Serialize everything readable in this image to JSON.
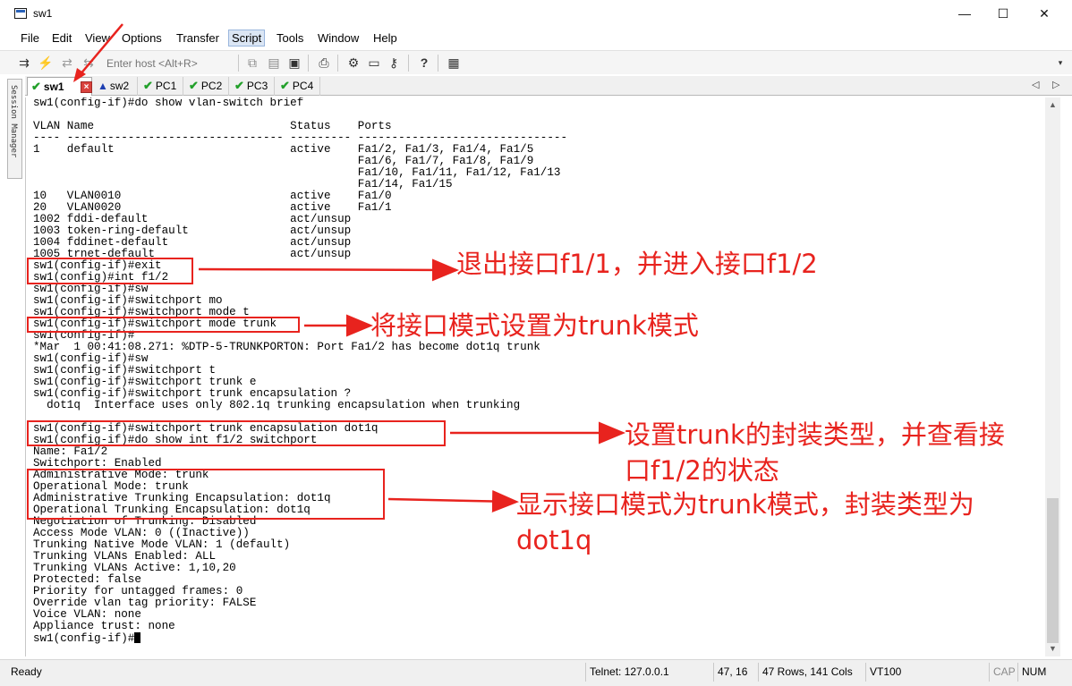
{
  "window": {
    "title": "sw1",
    "minimize": "—",
    "maximize": "☐",
    "close": "✕"
  },
  "menu": [
    "File",
    "Edit",
    "View",
    "Options",
    "Transfer",
    "Script",
    "Tools",
    "Window",
    "Help"
  ],
  "toolbar": {
    "host_placeholder": "Enter host <Alt+R>"
  },
  "tabs": [
    {
      "label": "sw1",
      "status": "connected",
      "active": true
    },
    {
      "label": "sw2",
      "status": "warning",
      "active": false
    },
    {
      "label": "PC1",
      "status": "connected",
      "active": false
    },
    {
      "label": "PC2",
      "status": "connected",
      "active": false
    },
    {
      "label": "PC3",
      "status": "connected",
      "active": false
    },
    {
      "label": "PC4",
      "status": "connected",
      "active": false
    }
  ],
  "session_manager": "Session Manager",
  "terminal_lines": [
    "sw1(config-if)#do show vlan-switch brief",
    "",
    "VLAN Name                             Status    Ports",
    "---- -------------------------------- --------- -------------------------------",
    "1    default                          active    Fa1/2, Fa1/3, Fa1/4, Fa1/5",
    "                                                Fa1/6, Fa1/7, Fa1/8, Fa1/9",
    "                                                Fa1/10, Fa1/11, Fa1/12, Fa1/13",
    "                                                Fa1/14, Fa1/15",
    "10   VLAN0010                         active    Fa1/0",
    "20   VLAN0020                         active    Fa1/1",
    "1002 fddi-default                     act/unsup",
    "1003 token-ring-default               act/unsup",
    "1004 fddinet-default                  act/unsup",
    "1005 trnet-default                    act/unsup",
    "sw1(config-if)#exit",
    "sw1(config)#int f1/2",
    "sw1(config-if)#sw",
    "sw1(config-if)#switchport mo",
    "sw1(config-if)#switchport mode t",
    "sw1(config-if)#switchport mode trunk",
    "sw1(config-if)#",
    "*Mar  1 00:41:08.271: %DTP-5-TRUNKPORTON: Port Fa1/2 has become dot1q trunk",
    "sw1(config-if)#sw",
    "sw1(config-if)#switchport t",
    "sw1(config-if)#switchport trunk e",
    "sw1(config-if)#switchport trunk encapsulation ?",
    "  dot1q  Interface uses only 802.1q trunking encapsulation when trunking",
    "",
    "sw1(config-if)#switchport trunk encapsulation dot1q",
    "sw1(config-if)#do show int f1/2 switchport",
    "Name: Fa1/2",
    "Switchport: Enabled",
    "Administrative Mode: trunk",
    "Operational Mode: trunk",
    "Administrative Trunking Encapsulation: dot1q",
    "Operational Trunking Encapsulation: dot1q",
    "Negotiation of Trunking: Disabled",
    "Access Mode VLAN: 0 ((Inactive))",
    "Trunking Native Mode VLAN: 1 (default)",
    "Trunking VLANs Enabled: ALL",
    "Trunking VLANs Active: 1,10,20",
    "Protected: false",
    "Priority for untagged frames: 0",
    "Override vlan tag priority: FALSE",
    "Voice VLAN: none",
    "Appliance trust: none",
    "sw1(config-if)#"
  ],
  "annotations": {
    "exit_int": "退出接口f1/1，并进入接口f1/2",
    "mode_trunk": "将接口模式设置为trunk模式",
    "encap_line1": "设置trunk的封装类型，并查看接",
    "encap_line2": "口f1/2的状态",
    "show_line1": "显示接口模式为trunk模式，封装类型为",
    "show_line2": "dot1q"
  },
  "status": {
    "state": "Ready",
    "connection": "Telnet: 127.0.0.1",
    "cursor": "47,  16",
    "size": "47 Rows, 141 Cols",
    "emulation": "VT100",
    "caps": "CAP",
    "num": "NUM"
  },
  "colors": {
    "annotation": "#e8231e",
    "check": "#22a02a",
    "warn": "#1e3fb2"
  }
}
